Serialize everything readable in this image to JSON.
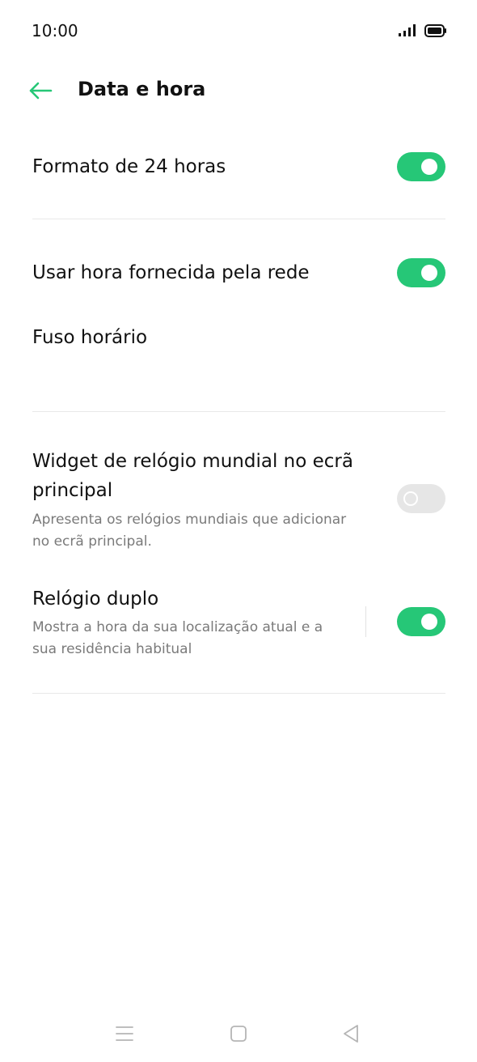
{
  "status_bar": {
    "time": "10:00",
    "icons": [
      "signal-icon",
      "battery-icon"
    ]
  },
  "header": {
    "back_icon": "arrow-left-icon",
    "title": "Data e hora"
  },
  "settings": {
    "format_24h": {
      "label": "Formato de 24 horas",
      "enabled": true
    },
    "network_time": {
      "label": "Usar hora fornecida pela rede",
      "enabled": true
    },
    "timezone": {
      "label": "Fuso horário"
    },
    "world_clock_widget": {
      "label_line1": "Widget de relógio mundial no ecrã",
      "label_line2": "principal",
      "desc_line1": "Apresenta os relógios mundiais que adicionar",
      "desc_line2": "no ecrã principal.",
      "enabled": false
    },
    "dual_clock": {
      "label": "Relógio duplo",
      "desc_line1": "Mostra a hora da sua localização atual e a",
      "desc_line2": "sua residência habitual",
      "enabled": true
    }
  },
  "nav_bar": {
    "icons": [
      "menu-icon",
      "home-icon",
      "back-triangle-icon"
    ]
  },
  "colors": {
    "accent": "#26c777",
    "toggle_off": "#e6e6e6",
    "secondary_text": "#7a7a7a"
  }
}
